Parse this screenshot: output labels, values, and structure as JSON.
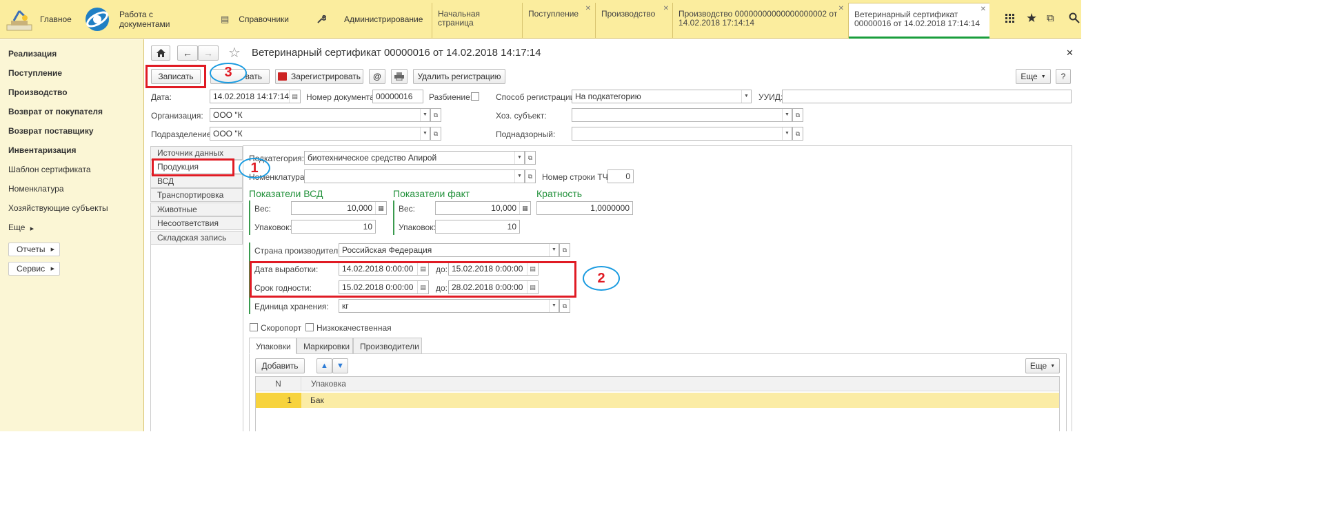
{
  "topbar": {
    "home_label": "Главное",
    "sections": [
      {
        "label": "Работа с документами"
      },
      {
        "label": "Справочники"
      },
      {
        "label": "Администрирование"
      }
    ],
    "tabs": [
      {
        "label": "Начальная страница"
      },
      {
        "label": "Поступление"
      },
      {
        "label": "Производство"
      },
      {
        "label": "Производство 00000000000000000002 от 14.02.2018 17:14:14"
      },
      {
        "label": "Ветеринарный сертификат 00000016 от 14.02.2018 17:14:14"
      }
    ]
  },
  "sidebar": {
    "bold_items": [
      "Реализация",
      "Поступление",
      "Производство",
      "Возврат от покупателя",
      "Возврат поставщику",
      "Инвентаризация"
    ],
    "items": [
      "Шаблон сертификата",
      "Номенклатура",
      "Хозяйствующие субъекты",
      "Еще"
    ],
    "buttons": [
      "Отчеты",
      "Сервис"
    ]
  },
  "form": {
    "title": "Ветеринарный сертификат 00000016 от 14.02.2018 14:17:14",
    "toolbar": {
      "write": "Записать",
      "post_partial": "вать",
      "register": "Зарегистрировать",
      "at": "@",
      "delete_registration": "Удалить регистрацию",
      "more": "Еще",
      "help": "?"
    },
    "header": {
      "date_label": "Дата:",
      "date_value": "14.02.2018 14:17:14",
      "docnum_label": "Номер документа:",
      "docnum_value": "00000016",
      "split_label": "Разбиение:",
      "regmethod_label": "Способ регистрации:",
      "regmethod_value": "На подкатегорию",
      "uuid_label": "УУИД:",
      "uuid_value": "",
      "org_label": "Организация:",
      "org_value": "ООО \"К",
      "subject_label": "Хоз. субъект:",
      "subject_value": "",
      "dept_label": "Подразделение:",
      "dept_value": "ООО \"К",
      "supervised_label": "Поднадзорный:",
      "supervised_value": ""
    },
    "nav_tabs": [
      "Источник данных",
      "Продукция",
      "ВСД",
      "Транспортировка",
      "Животные",
      "Несоответствия",
      "Складская запись"
    ],
    "product": {
      "subcat_label": "Подкатегория:",
      "subcat_value": "биотехническое средство Апирой",
      "nomen_label": "Номенклатура:",
      "nomen_value": "",
      "rownum_label": "Номер строки ТЧ:",
      "rownum_value": "0",
      "vsd_title": "Показатели ВСД",
      "fact_title": "Показатели факт",
      "mult_title": "Кратность",
      "weight_label": "Вес:",
      "packs_label": "Упаковок:",
      "vsd_weight": "10,000",
      "vsd_packs": "10",
      "fact_weight": "10,000",
      "fact_packs": "10",
      "mult_value": "1,0000000",
      "country_label": "Страна производитель:",
      "country_value": "Российская Федерация",
      "prod_date_label": "Дата выработки:",
      "prod_date_from": "14.02.2018  0:00:00",
      "to_label": "до:",
      "prod_date_to": "15.02.2018  0:00:00",
      "expiry_label": "Срок годности:",
      "expiry_from": "15.02.2018  0:00:00",
      "expiry_to": "28.02.2018  0:00:00",
      "unit_label": "Единица хранения:",
      "unit_value": "кг",
      "perishable_label": "Скоропорт",
      "lowquality_label": "Низкокачественная"
    },
    "subtabs": [
      "Упаковки",
      "Маркировки",
      "Производители"
    ],
    "table": {
      "add": "Добавить",
      "more": "Еще",
      "headers": [
        "N",
        "Упаковка"
      ],
      "rows": [
        {
          "n": "1",
          "pack": "Бак"
        }
      ]
    },
    "annotations": {
      "a1": "1",
      "a2": "2",
      "a3": "3"
    }
  }
}
